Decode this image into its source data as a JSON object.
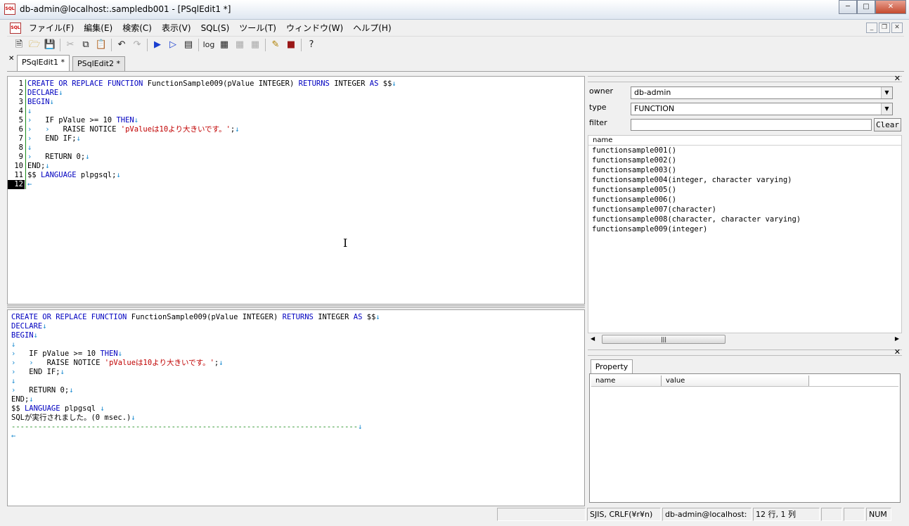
{
  "window": {
    "title": "db-admin@localhost:.sampledb001 - [PSqlEdit1 *]",
    "app_icon_text": "SQL"
  },
  "menu": [
    "ファイル(F)",
    "編集(E)",
    "検索(C)",
    "表示(V)",
    "SQL(S)",
    "ツール(T)",
    "ウィンドウ(W)",
    "ヘルプ(H)"
  ],
  "toolbar": {
    "icons": [
      "new-file-icon",
      "open-folder-icon",
      "save-icon",
      "cut-icon",
      "copy-icon",
      "paste-icon",
      "undo-icon",
      "redo-icon",
      "run-icon",
      "run-step-icon",
      "explain-icon",
      "log-icon",
      "grid-icon",
      "grid-alt-icon",
      "grid-alt2-icon",
      "pencil-icon",
      "book-icon",
      "help-icon"
    ],
    "log_label": "log"
  },
  "tabs": [
    {
      "label": "PSqlEdit1 *",
      "active": true
    },
    {
      "label": "PSqlEdit2 *",
      "active": false
    }
  ],
  "editor": {
    "current_line": 12,
    "lines": [
      {
        "n": "1",
        "parts": [
          [
            "kw",
            "CREATE OR REPLACE FUNCTION "
          ],
          [
            "t",
            "FunctionSample009(pValue INTEGER) "
          ],
          [
            "kw",
            "RETURNS "
          ],
          [
            "t",
            "INTEGER "
          ],
          [
            "kw",
            "AS "
          ],
          [
            "t",
            "$$"
          ],
          [
            "ar",
            "↓"
          ]
        ]
      },
      {
        "n": "2",
        "parts": [
          [
            "kw",
            "DECLARE"
          ],
          [
            "ar",
            "↓"
          ]
        ]
      },
      {
        "n": "3",
        "parts": [
          [
            "kw",
            "BEGIN"
          ],
          [
            "ar",
            "↓"
          ]
        ]
      },
      {
        "n": "4",
        "parts": [
          [
            "ar",
            "↓"
          ]
        ]
      },
      {
        "n": "5",
        "parts": [
          [
            "ar",
            "›   "
          ],
          [
            "t",
            "IF pValue >= 10 "
          ],
          [
            "kw",
            "THEN"
          ],
          [
            "ar",
            "↓"
          ]
        ]
      },
      {
        "n": "6",
        "parts": [
          [
            "ar",
            "›   ›   "
          ],
          [
            "t",
            "RAISE NOTICE "
          ],
          [
            "str",
            "'pValueは10より大きいです。'"
          ],
          [
            "t",
            ";"
          ],
          [
            "ar",
            "↓"
          ]
        ]
      },
      {
        "n": "7",
        "parts": [
          [
            "ar",
            "›   "
          ],
          [
            "t",
            "END IF;"
          ],
          [
            "ar",
            "↓"
          ]
        ]
      },
      {
        "n": "8",
        "parts": [
          [
            "ar",
            "↓"
          ]
        ]
      },
      {
        "n": "9",
        "parts": [
          [
            "ar",
            "›   "
          ],
          [
            "t",
            "RETURN 0;"
          ],
          [
            "ar",
            "↓"
          ]
        ]
      },
      {
        "n": "10",
        "parts": [
          [
            "t",
            "END;"
          ],
          [
            "ar",
            "↓"
          ]
        ]
      },
      {
        "n": "11",
        "parts": [
          [
            "t",
            "$$ "
          ],
          [
            "kw",
            "LANGUAGE "
          ],
          [
            "t",
            "plpgsql;"
          ],
          [
            "ar",
            "↓"
          ]
        ]
      },
      {
        "n": "12",
        "parts": [
          [
            "ar",
            "←"
          ]
        ]
      }
    ]
  },
  "result": {
    "lines": [
      {
        "parts": [
          [
            "kw",
            "CREATE OR REPLACE FUNCTION "
          ],
          [
            "t",
            "FunctionSample009(pValue INTEGER) "
          ],
          [
            "kw",
            "RETURNS "
          ],
          [
            "t",
            "INTEGER "
          ],
          [
            "kw",
            "AS "
          ],
          [
            "t",
            "$$"
          ],
          [
            "ar",
            "↓"
          ]
        ]
      },
      {
        "parts": [
          [
            "kw",
            "DECLARE"
          ],
          [
            "ar",
            "↓"
          ]
        ]
      },
      {
        "parts": [
          [
            "kw",
            "BEGIN"
          ],
          [
            "ar",
            "↓"
          ]
        ]
      },
      {
        "parts": [
          [
            "ar",
            "↓"
          ]
        ]
      },
      {
        "parts": [
          [
            "ar",
            "›   "
          ],
          [
            "t",
            "IF pValue >= 10 "
          ],
          [
            "kw",
            "THEN"
          ],
          [
            "ar",
            "↓"
          ]
        ]
      },
      {
        "parts": [
          [
            "ar",
            "›   ›   "
          ],
          [
            "t",
            "RAISE NOTICE "
          ],
          [
            "str",
            "'pValueは10より大きいです。'"
          ],
          [
            "t",
            ";"
          ],
          [
            "ar",
            "↓"
          ]
        ]
      },
      {
        "parts": [
          [
            "ar",
            "›   "
          ],
          [
            "t",
            "END IF;"
          ],
          [
            "ar",
            "↓"
          ]
        ]
      },
      {
        "parts": [
          [
            "ar",
            "↓"
          ]
        ]
      },
      {
        "parts": [
          [
            "ar",
            "›   "
          ],
          [
            "t",
            "RETURN 0;"
          ],
          [
            "ar",
            "↓"
          ]
        ]
      },
      {
        "parts": [
          [
            "t",
            "END;"
          ],
          [
            "ar",
            "↓"
          ]
        ]
      },
      {
        "parts": [
          [
            "t",
            "$$ "
          ],
          [
            "kw",
            "LANGUAGE "
          ],
          [
            "t",
            "plpgsql "
          ],
          [
            "ar",
            "↓"
          ]
        ]
      },
      {
        "parts": [
          [
            "t",
            "SQLが実行されました。(0 msec.)"
          ],
          [
            "ar",
            "↓"
          ]
        ]
      },
      {
        "parts": [
          [
            "dash",
            "------------------------------------------------------------------------------"
          ],
          [
            "ar",
            "↓"
          ]
        ]
      },
      {
        "parts": [
          [
            "ar",
            "←"
          ]
        ]
      }
    ]
  },
  "object_panel": {
    "owner_label": "owner",
    "owner_value": "db-admin",
    "type_label": "type",
    "type_value": "FUNCTION",
    "filter_label": "filter",
    "filter_value": "",
    "clear_label": "Clear",
    "list_header": "name",
    "items": [
      "functionsample001()",
      "functionsample002()",
      "functionsample003()",
      "functionsample004(integer, character varying)",
      "functionsample005()",
      "functionsample006()",
      "functionsample007(character)",
      "functionsample008(character, character varying)",
      "functionsample009(integer)"
    ]
  },
  "property_panel": {
    "tab_label": "Property",
    "col_name": "name",
    "col_value": "value"
  },
  "status": {
    "encoding": "SJIS, CRLF(¥r¥n)",
    "connection": "db-admin@localhost:",
    "position": "12 行, 1 列",
    "num": "NUM"
  }
}
